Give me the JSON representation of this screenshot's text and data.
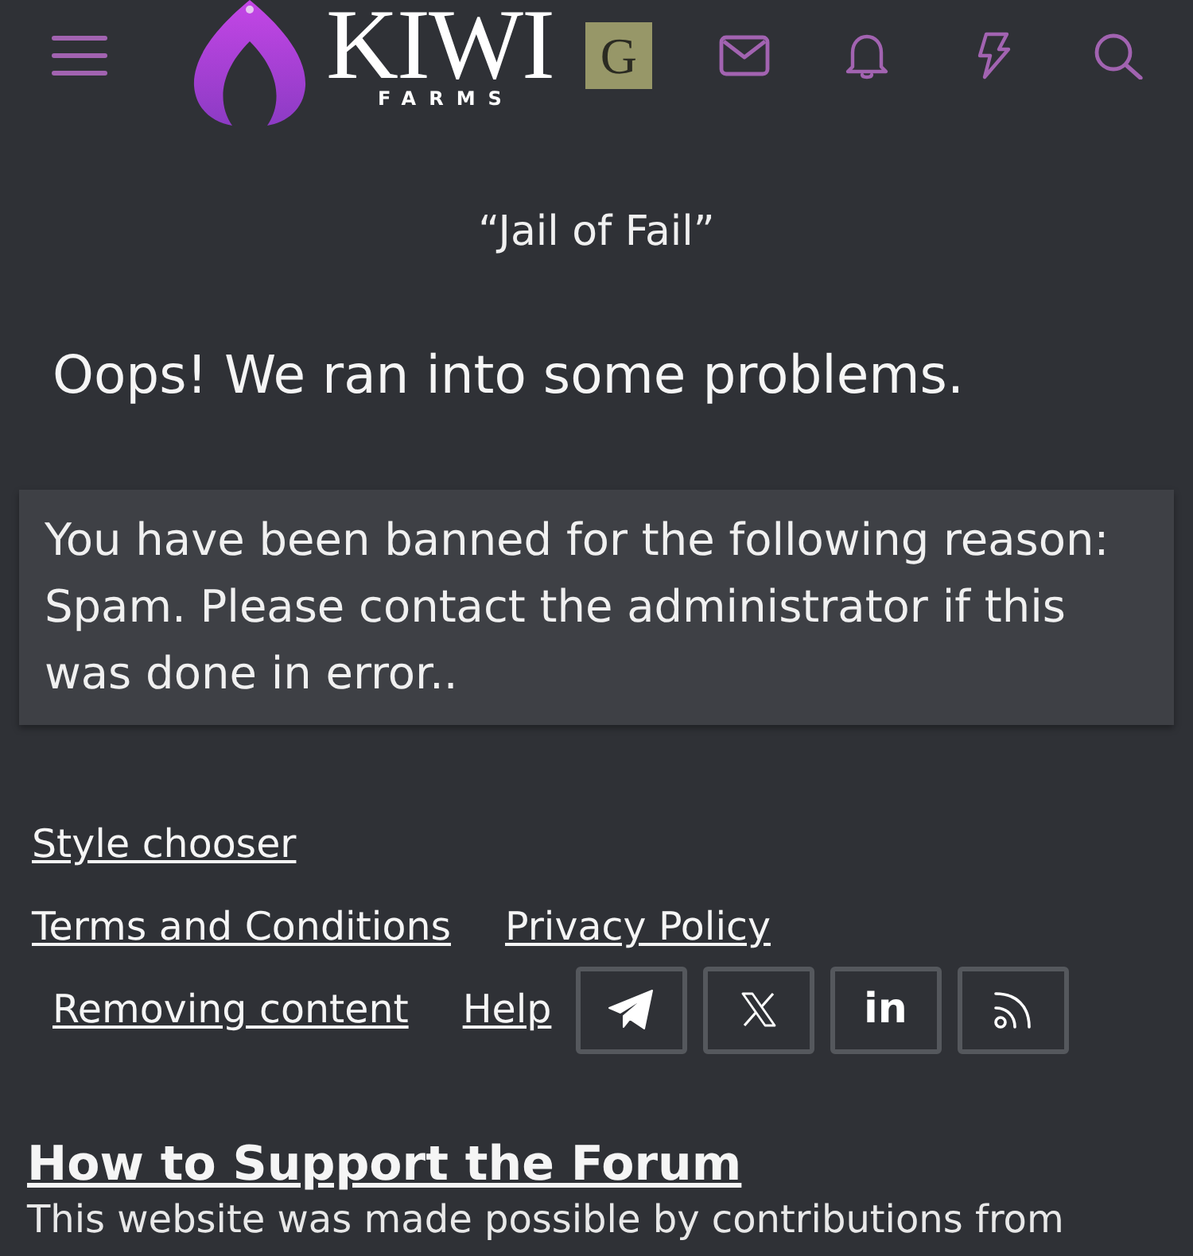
{
  "header": {
    "logo": {
      "wordmark": "KIWI",
      "tagline": "FARMS"
    },
    "avatar": {
      "letter": "G"
    }
  },
  "page": {
    "title": "“Jail of Fail”",
    "heading": "Oops! We ran into some problems.",
    "message": "You have been banned for the following reason: Spam. Please contact the administrator if this was done in error.."
  },
  "footer": {
    "style_chooser": "Style chooser",
    "link_rows": [
      [
        "Terms and Conditions",
        "Privacy Policy"
      ],
      [
        "Removing content",
        "Help"
      ]
    ],
    "social": [
      {
        "kind": "telegram"
      },
      {
        "kind": "x"
      },
      {
        "kind": "linkedin",
        "label": "in"
      },
      {
        "kind": "rss"
      }
    ]
  },
  "support": {
    "title": "How to Support the Forum",
    "text": "This website was made possible by contributions from"
  }
}
